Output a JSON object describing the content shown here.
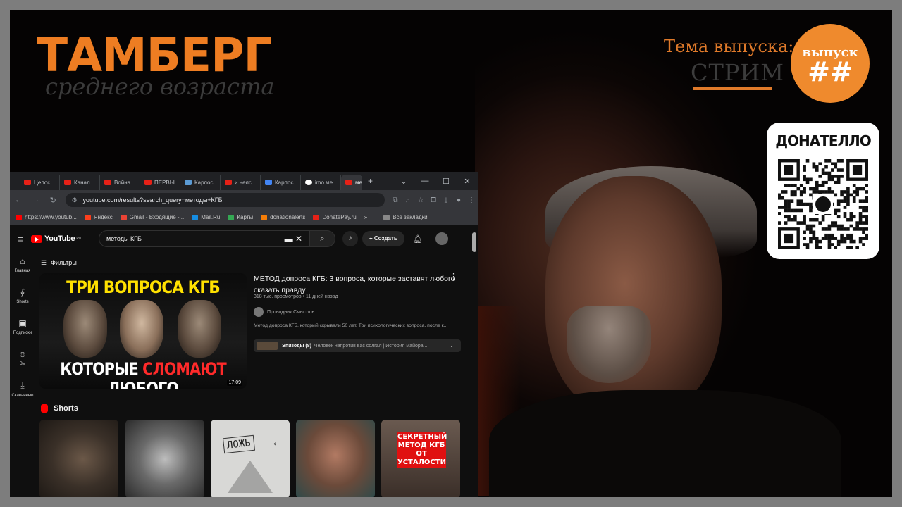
{
  "branding": {
    "title": "ТАМБЕРГ",
    "subtitle": "среднего возраста",
    "accent_color": "#ee7d22"
  },
  "episode": {
    "label": "Тема выпуска:",
    "topic": "СТРИМ",
    "badge_word": "выпуск",
    "badge_number": "##"
  },
  "donation": {
    "title": "ДОНАТЕЛЛО",
    "qr_icon": "qr-code-icon"
  },
  "browser": {
    "tabs": [
      {
        "label": "Целос",
        "icon": "youtube-icon"
      },
      {
        "label": "Канал",
        "icon": "youtube-icon"
      },
      {
        "label": "Война",
        "icon": "youtube-icon"
      },
      {
        "label": "ПЕРВЫ",
        "icon": "youtube-icon"
      },
      {
        "label": "Карлос",
        "icon": "bookmark-icon"
      },
      {
        "label": "и нелс",
        "icon": "youtube-icon"
      },
      {
        "label": "Карлос",
        "icon": "site-icon"
      },
      {
        "label": "imo ме",
        "icon": "google-icon"
      },
      {
        "label": "ме",
        "icon": "youtube-icon"
      }
    ],
    "new_tab": "+",
    "window_controls": [
      "⌄",
      "—",
      "☐",
      "✕"
    ],
    "url": "youtube.com/results?search_query=методы+КГБ",
    "bookmarks": [
      {
        "label": "https://www.youtub...",
        "color": "#ff0000"
      },
      {
        "label": "Яндекс",
        "color": "#fc3f1d"
      },
      {
        "label": "Gmail - Входящие -...",
        "color": "#ea4335"
      },
      {
        "label": "Mail.Ru",
        "color": "#168de2"
      },
      {
        "label": "Карты",
        "color": "#34a853"
      },
      {
        "label": "donationalerts",
        "color": "#f57d07"
      },
      {
        "label": "DonatePay.ru",
        "color": "#e62117"
      },
      {
        "label": "»",
        "color": "transparent"
      },
      {
        "label": "Все закладки",
        "color": "#888888"
      }
    ]
  },
  "youtube": {
    "logo_text": "YouTube",
    "logo_region": "RU",
    "search_value": "методы КГБ",
    "create_label": "Создать",
    "sidebar": [
      {
        "label": "Главная",
        "icon": "home-icon",
        "glyph": "⌂"
      },
      {
        "label": "Shorts",
        "icon": "shorts-icon",
        "glyph": "∮"
      },
      {
        "label": "Подписки",
        "icon": "subscriptions-icon",
        "glyph": "▣"
      },
      {
        "label": "Вы",
        "icon": "user-icon",
        "glyph": "☺"
      },
      {
        "label": "Скачанные",
        "icon": "download-icon",
        "glyph": "⤓"
      }
    ],
    "filters_label": "Фильтры",
    "video": {
      "thumb_top": "ТРИ ВОПРОСА КГБ",
      "thumb_bottom_1": "КОТОРЫЕ ",
      "thumb_bottom_red": "СЛОМАЮТ",
      "thumb_bottom_2": " ЛЮБОГО",
      "duration": "17:09",
      "title": "МЕТОД допроса КГБ: 3 вопроса, которые заставят любого сказать правду",
      "meta": "318 тыс. просмотров • 11 дней назад",
      "channel": "Проводник Смыслов",
      "description": "Метод допроса КГБ, который скрывали 50 лет. Три психологических вопроса, после к...",
      "episodes_label": "Эпизоды (8)",
      "episodes_text": "Человек напротив вас солгал | История майора..."
    },
    "shorts_label": "Shorts",
    "shorts": [
      {
        "caption": ""
      },
      {
        "caption": ""
      },
      {
        "caption": "ЛОЖЬ"
      },
      {
        "caption": ""
      },
      {
        "caption": "СЕКРЕТНЫЙ МЕТОД КГБ ОТ УСТАЛОСТИ"
      }
    ]
  }
}
